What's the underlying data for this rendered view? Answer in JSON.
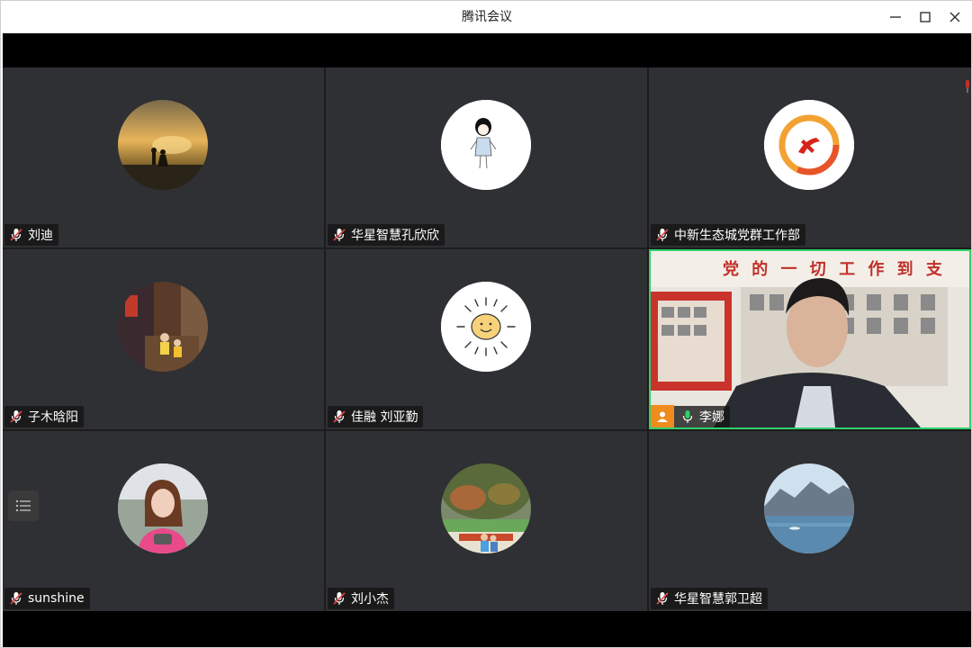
{
  "window": {
    "title": "腾讯会议",
    "controls": [
      "minimize",
      "maximize",
      "close"
    ]
  },
  "participants": [
    {
      "name": "刘迪",
      "mic": "muted",
      "avatar": "sunset-couple-photo"
    },
    {
      "name": "华星智慧孔欣欣",
      "mic": "muted",
      "avatar": "cartoon-girl-drawing"
    },
    {
      "name": "中新生态城党群工作部",
      "mic": "muted",
      "avatar": "party-emblem-logo"
    },
    {
      "name": "子木晗阳",
      "mic": "muted",
      "avatar": "street-photo"
    },
    {
      "name": "佳融 刘亚勤",
      "mic": "muted",
      "avatar": "smiling-sun-drawing"
    },
    {
      "name": "李娜",
      "mic": "active",
      "video": true,
      "host": true,
      "banner_text": "党 的 一 切 工 作 到 支"
    },
    {
      "name": "sunshine",
      "mic": "muted",
      "avatar": "woman-portrait-photo"
    },
    {
      "name": "刘小杰",
      "mic": "muted",
      "avatar": "family-park-photo"
    },
    {
      "name": "华星智慧郭卫超",
      "mic": "muted",
      "avatar": "lake-mountain-photo"
    }
  ],
  "colors": {
    "tile_bg": "#2e3033",
    "active_speaker_border": "#2fd06b",
    "host_badge": "#f08c1e",
    "muted_mic": "#e04848"
  }
}
